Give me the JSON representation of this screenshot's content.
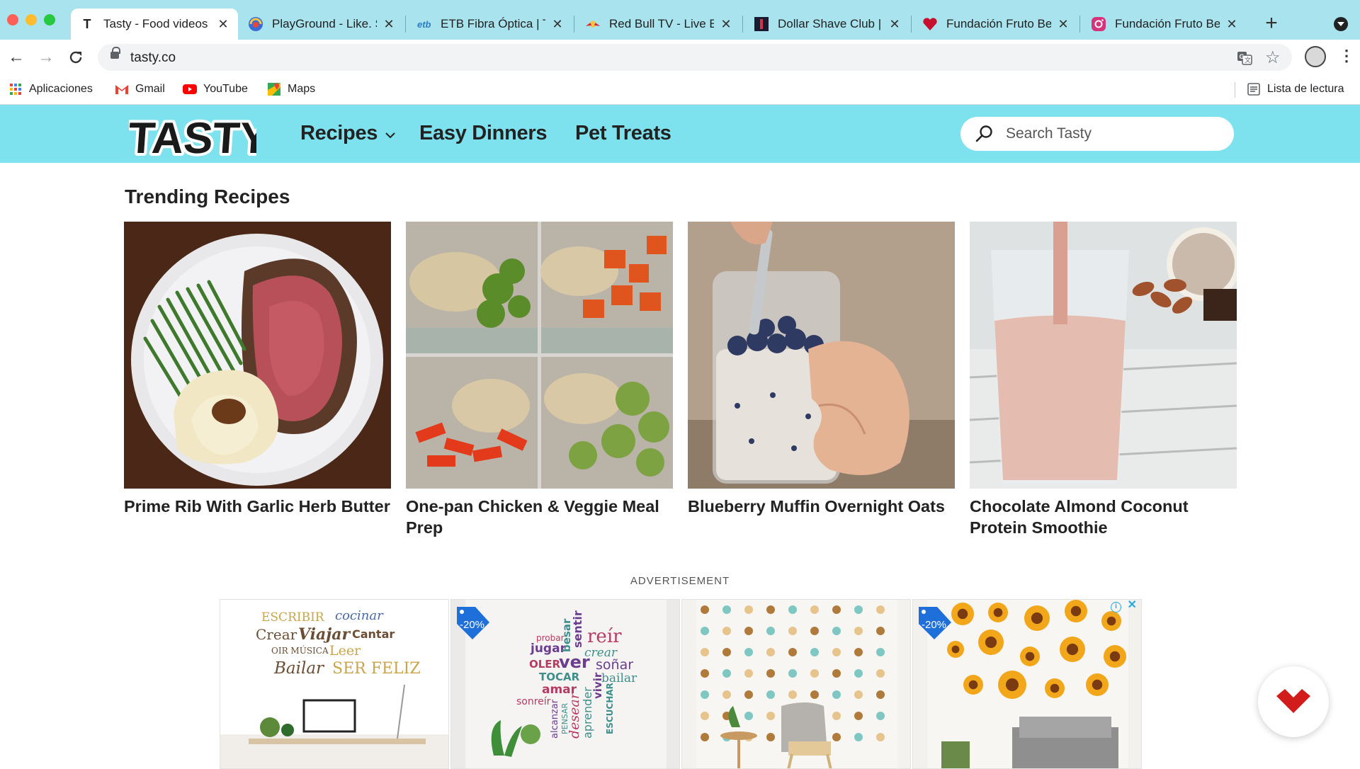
{
  "browser": {
    "tabs": [
      {
        "title": "Tasty - Food videos",
        "favicon": "tasty-t-icon",
        "active": true
      },
      {
        "title": "PlayGround - Like. S",
        "favicon": "playground-icon",
        "active": false
      },
      {
        "title": "ETB Fibra Óptica | T",
        "favicon": "etb-icon",
        "active": false
      },
      {
        "title": "Red Bull TV - Live E",
        "favicon": "redbull-icon",
        "active": false
      },
      {
        "title": "Dollar Shave Club |",
        "favicon": "dollar-shave-club-icon",
        "active": false
      },
      {
        "title": "Fundación Fruto Be",
        "favicon": "heart-icon",
        "active": false
      },
      {
        "title": "Fundación Fruto Be",
        "favicon": "instagram-icon",
        "active": false
      }
    ],
    "new_tab_label": "+",
    "url": "tasty.co",
    "bookmarks": [
      {
        "label": "Aplicaciones",
        "icon": "apps-grid-icon"
      },
      {
        "label": "Gmail",
        "icon": "gmail-icon"
      },
      {
        "label": "YouTube",
        "icon": "youtube-icon"
      },
      {
        "label": "Maps",
        "icon": "maps-icon"
      }
    ],
    "reading_list_label": "Lista de lectura"
  },
  "site": {
    "logo_text": "TASTY",
    "nav": [
      {
        "label": "Recipes",
        "has_dropdown": true
      },
      {
        "label": "Easy Dinners",
        "has_dropdown": false
      },
      {
        "label": "Pet Treats",
        "has_dropdown": false
      }
    ],
    "search_placeholder": "Search Tasty",
    "colors": {
      "header_bg": "#7ee1ee",
      "text": "#222222"
    }
  },
  "trending": {
    "title": "Trending Recipes",
    "recipes": [
      {
        "name": "Prime Rib With Garlic Herb Butter"
      },
      {
        "name": "One-pan Chicken & Veggie Meal Prep"
      },
      {
        "name": "Blueberry Muffin Overnight Oats"
      },
      {
        "name": "Chocolate Almond Coconut Protein Smoothie"
      }
    ]
  },
  "advertisement": {
    "label": "ADVERTISEMENT",
    "tiles": [
      {
        "words": [
          "ESCRIBIR",
          "cocinar",
          "Crear",
          "Viajar",
          "Cantar",
          "OIR MÚSICA",
          "Leer",
          "Bailar",
          "SER FELIZ"
        ],
        "discount": ""
      },
      {
        "words": [
          "probar",
          "jugar",
          "besar",
          "sentir",
          "reír",
          "crear",
          "OLER",
          "ver",
          "soñar",
          "TOCAR",
          "bailar",
          "amar",
          "sonreír",
          "vivir",
          "ESCUCHAR",
          "alcanzar",
          "PENSAR",
          "desear",
          "aprender"
        ],
        "discount": "-20%"
      },
      {
        "words": [],
        "discount": ""
      },
      {
        "words": [],
        "discount": "-20%"
      }
    ],
    "info_icon": "info-icon",
    "close_icon": "close-icon"
  }
}
